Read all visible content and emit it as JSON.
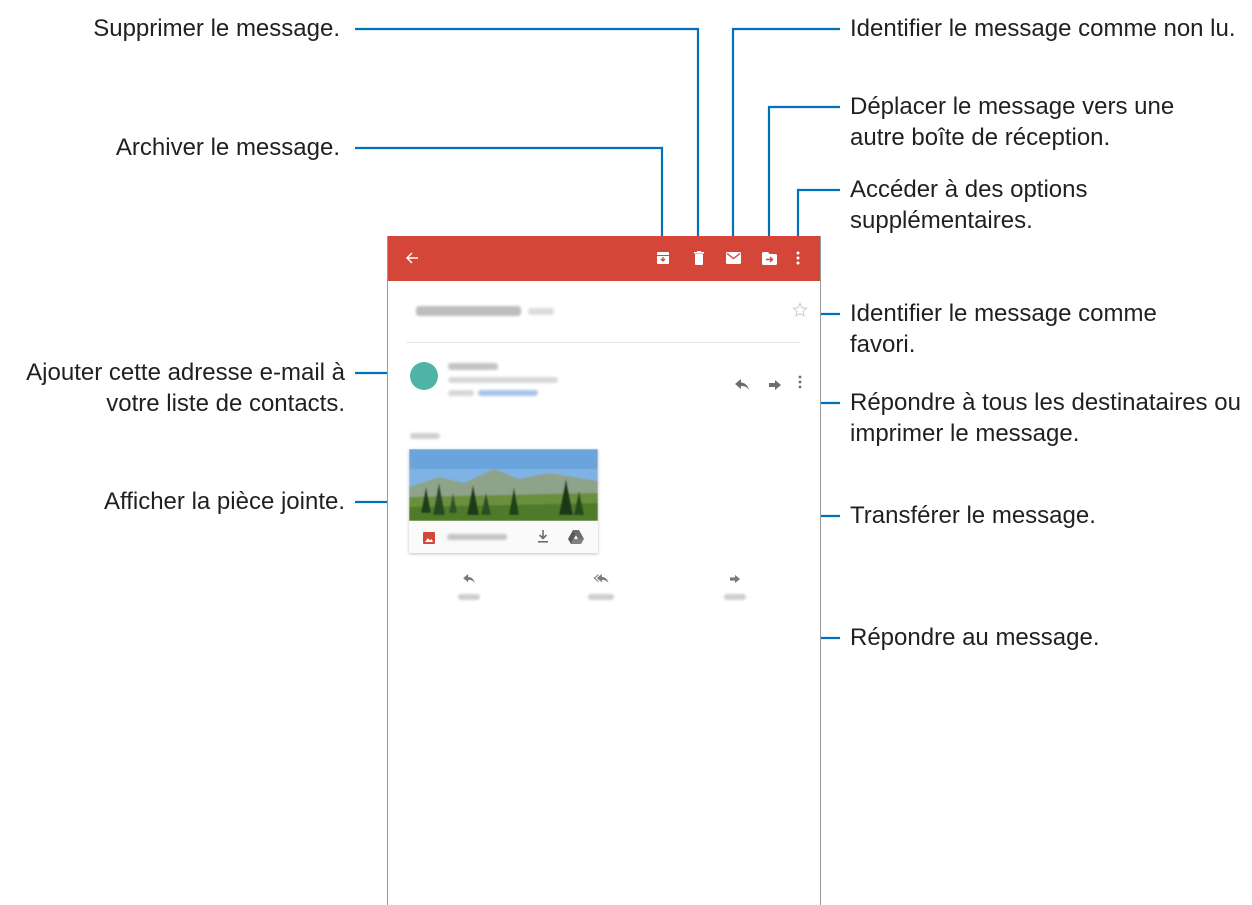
{
  "callouts": {
    "delete": "Supprimer le message.",
    "archive": "Archiver le message.",
    "mark_unread": "Identifier le message comme non lu.",
    "move": "Déplacer le message vers une autre boîte de réception.",
    "more_options": "Accéder à des options supplémentaires.",
    "favorite": "Identifier le message comme favori.",
    "add_contact": "Ajouter cette adresse e-mail à votre liste de contacts.",
    "reply_all_print": "Répondre à tous les destinataires ou imprimer le message.",
    "view_attachment": "Afficher la pièce jointe.",
    "forward": "Transférer le message.",
    "reply": "Répondre au message."
  },
  "app": {
    "accent": "#d44638",
    "avatar_color": "#4fb3a6",
    "toolbar_icons": [
      "back-arrow-icon",
      "archive-icon",
      "delete-icon",
      "mark-unread-icon",
      "move-to-icon",
      "more-vert-icon"
    ],
    "message_icons": [
      "reply-icon",
      "forward-icon",
      "more-vert-icon",
      "star-icon",
      "image-icon",
      "download-icon",
      "drive-icon",
      "reply-all-icon"
    ]
  },
  "colors": {
    "callout_text": "#231f20",
    "leader_line": "#0072bc",
    "frame_border": "#9a9a9a"
  }
}
